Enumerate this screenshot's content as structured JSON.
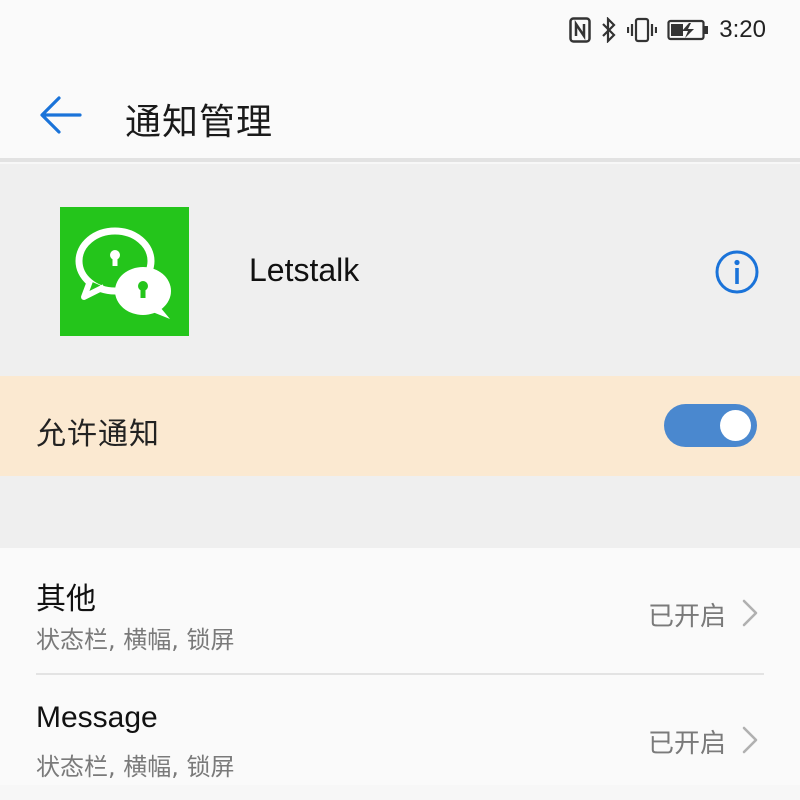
{
  "status_bar": {
    "icons": [
      "nfc-icon",
      "bluetooth-icon",
      "vibrate-icon",
      "battery-charging-icon"
    ],
    "time": "3:20"
  },
  "app_bar": {
    "back_icon": "arrow-left-icon",
    "title": "通知管理"
  },
  "app": {
    "name": "Letstalk",
    "icon": "chat-bubbles-lock-icon",
    "icon_color": "#24c51b",
    "info_icon": "info-circle-icon"
  },
  "allow_notifications": {
    "label": "允许通知",
    "enabled": true,
    "toggle_color": "#4a88cf"
  },
  "categories": [
    {
      "title": "其他",
      "subtitle": "状态栏, 横幅, 锁屏",
      "status": "已开启"
    },
    {
      "title": "Message",
      "subtitle": "状态栏, 横幅, 锁屏",
      "status": "已开启"
    }
  ],
  "colors": {
    "accent": "#1a73d9",
    "allow_row_bg": "#fbe9d1"
  }
}
